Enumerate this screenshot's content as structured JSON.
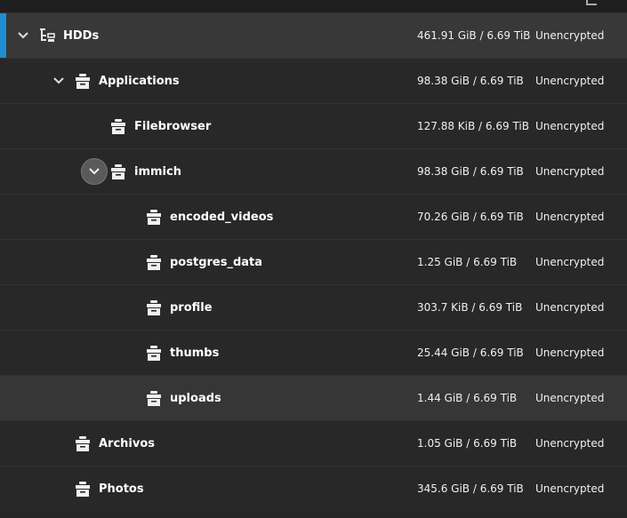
{
  "rows": [
    {
      "name": "HDDs",
      "used": "461.91 GiB / 6.69 TiB",
      "encryption": "Unencrypted"
    },
    {
      "name": "Applications",
      "used": "98.38 GiB / 6.69 TiB",
      "encryption": "Unencrypted"
    },
    {
      "name": "Filebrowser",
      "used": "127.88 KiB / 6.69 TiB",
      "encryption": "Unencrypted"
    },
    {
      "name": "immich",
      "used": "98.38 GiB / 6.69 TiB",
      "encryption": "Unencrypted"
    },
    {
      "name": "encoded_videos",
      "used": "70.26 GiB / 6.69 TiB",
      "encryption": "Unencrypted"
    },
    {
      "name": "postgres_data",
      "used": "1.25 GiB / 6.69 TiB",
      "encryption": "Unencrypted"
    },
    {
      "name": "profile",
      "used": "303.7 KiB / 6.69 TiB",
      "encryption": "Unencrypted"
    },
    {
      "name": "thumbs",
      "used": "25.44 GiB / 6.69 TiB",
      "encryption": "Unencrypted"
    },
    {
      "name": "uploads",
      "used": "1.44 GiB / 6.69 TiB",
      "encryption": "Unencrypted"
    },
    {
      "name": "Archivos",
      "used": "1.05 GiB / 6.69 TiB",
      "encryption": "Unencrypted"
    },
    {
      "name": "Photos",
      "used": "345.6 GiB / 6.69 TiB",
      "encryption": "Unencrypted"
    }
  ],
  "icons": {
    "expand": "chevron-down-icon",
    "pool": "pool-tree-icon",
    "dataset": "dataset-icon"
  },
  "colors": {
    "selected_accent": "#1e8fd0",
    "background": "#282828",
    "selected_row": "#383838"
  }
}
